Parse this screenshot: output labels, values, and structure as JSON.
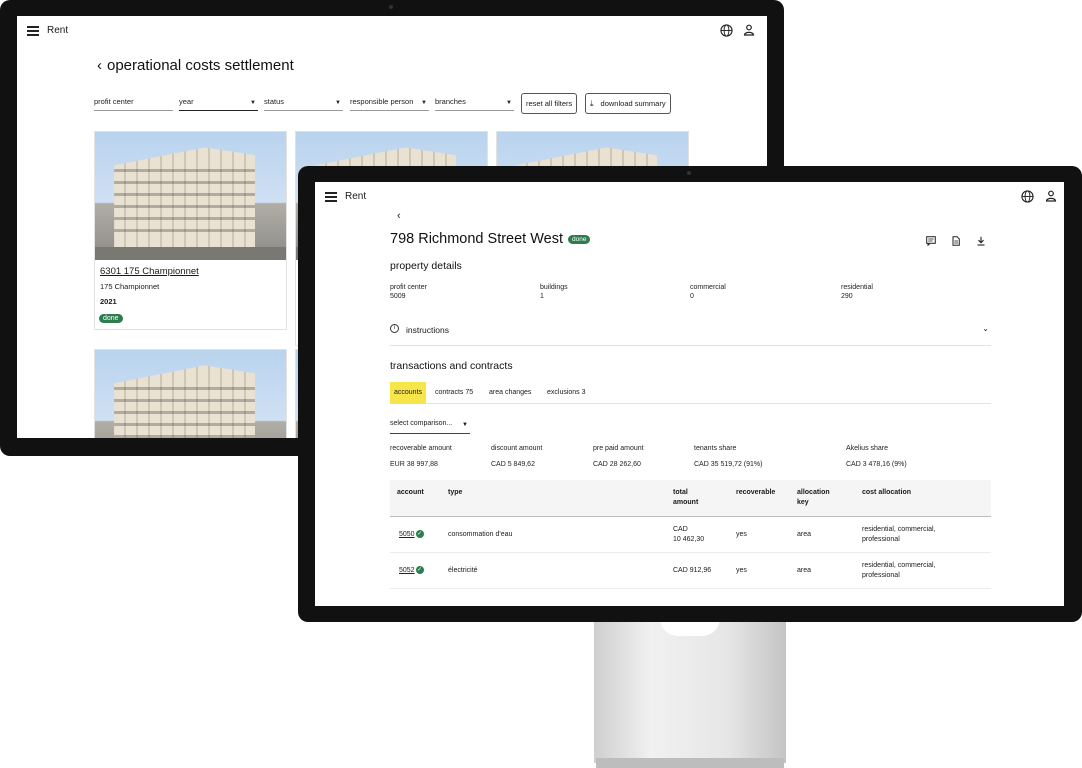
{
  "app": {
    "name": "Rent"
  },
  "back_screen": {
    "title": "operational costs settlement",
    "filters": [
      {
        "label": "profit center",
        "has_caret": false
      },
      {
        "label": "year",
        "has_caret": true
      },
      {
        "label": "status",
        "has_caret": true
      },
      {
        "label": "responsible person",
        "has_caret": true
      },
      {
        "label": "branches",
        "has_caret": true
      }
    ],
    "reset_label": "reset all filters",
    "download_label": "download summary",
    "cards": [
      {
        "name": "6301 175 Championnet",
        "address": "175 Championnet",
        "year": "2021",
        "status": "done"
      }
    ]
  },
  "front_screen": {
    "property": {
      "title": "798 Richmond Street West",
      "status": "done"
    },
    "property_details_heading": "property details",
    "details": [
      {
        "label": "profit center",
        "value": "5009"
      },
      {
        "label": "buildings",
        "value": "1"
      },
      {
        "label": "commercial",
        "value": "0"
      },
      {
        "label": "residential",
        "value": "290"
      }
    ],
    "instructions_label": "instructions",
    "transactions_heading": "transactions and contracts",
    "tabs": [
      {
        "label": "accounts",
        "active": true
      },
      {
        "label": "contracts 75",
        "active": false
      },
      {
        "label": "area changes",
        "active": false
      },
      {
        "label": "exclusions 3",
        "active": false
      }
    ],
    "comparison_placeholder": "select comparison...",
    "summary": [
      {
        "label": "recoverable amount",
        "value": "EUR 38 997,88"
      },
      {
        "label": "discount amount",
        "value": "CAD 5 849,62"
      },
      {
        "label": "pre paid amount",
        "value": "CAD 28 262,60"
      },
      {
        "label": "tenants share",
        "value": "CAD 35 519,72 (91%)"
      },
      {
        "label": "Akelius share",
        "value": "CAD 3 478,16 (9%)"
      }
    ],
    "table": {
      "headers": {
        "account": "account",
        "type": "type",
        "total_1": "total",
        "total_2": "amount",
        "recoverable": "recoverable",
        "allocation_1": "allocation",
        "allocation_2": "key",
        "cost_allocation": "cost allocation"
      },
      "rows": [
        {
          "account": "5050",
          "type": "consommation d'eau",
          "amount_1": "CAD",
          "amount_2": "10 462,30",
          "recoverable": "yes",
          "allocation_key": "area",
          "cost_1": "residential, commercial,",
          "cost_2": "professional"
        },
        {
          "account": "5052",
          "type": "électricité",
          "amount_1": "CAD 912,96",
          "amount_2": "",
          "recoverable": "yes",
          "allocation_key": "area",
          "cost_1": "residential, commercial,",
          "cost_2": "professional"
        }
      ]
    }
  }
}
